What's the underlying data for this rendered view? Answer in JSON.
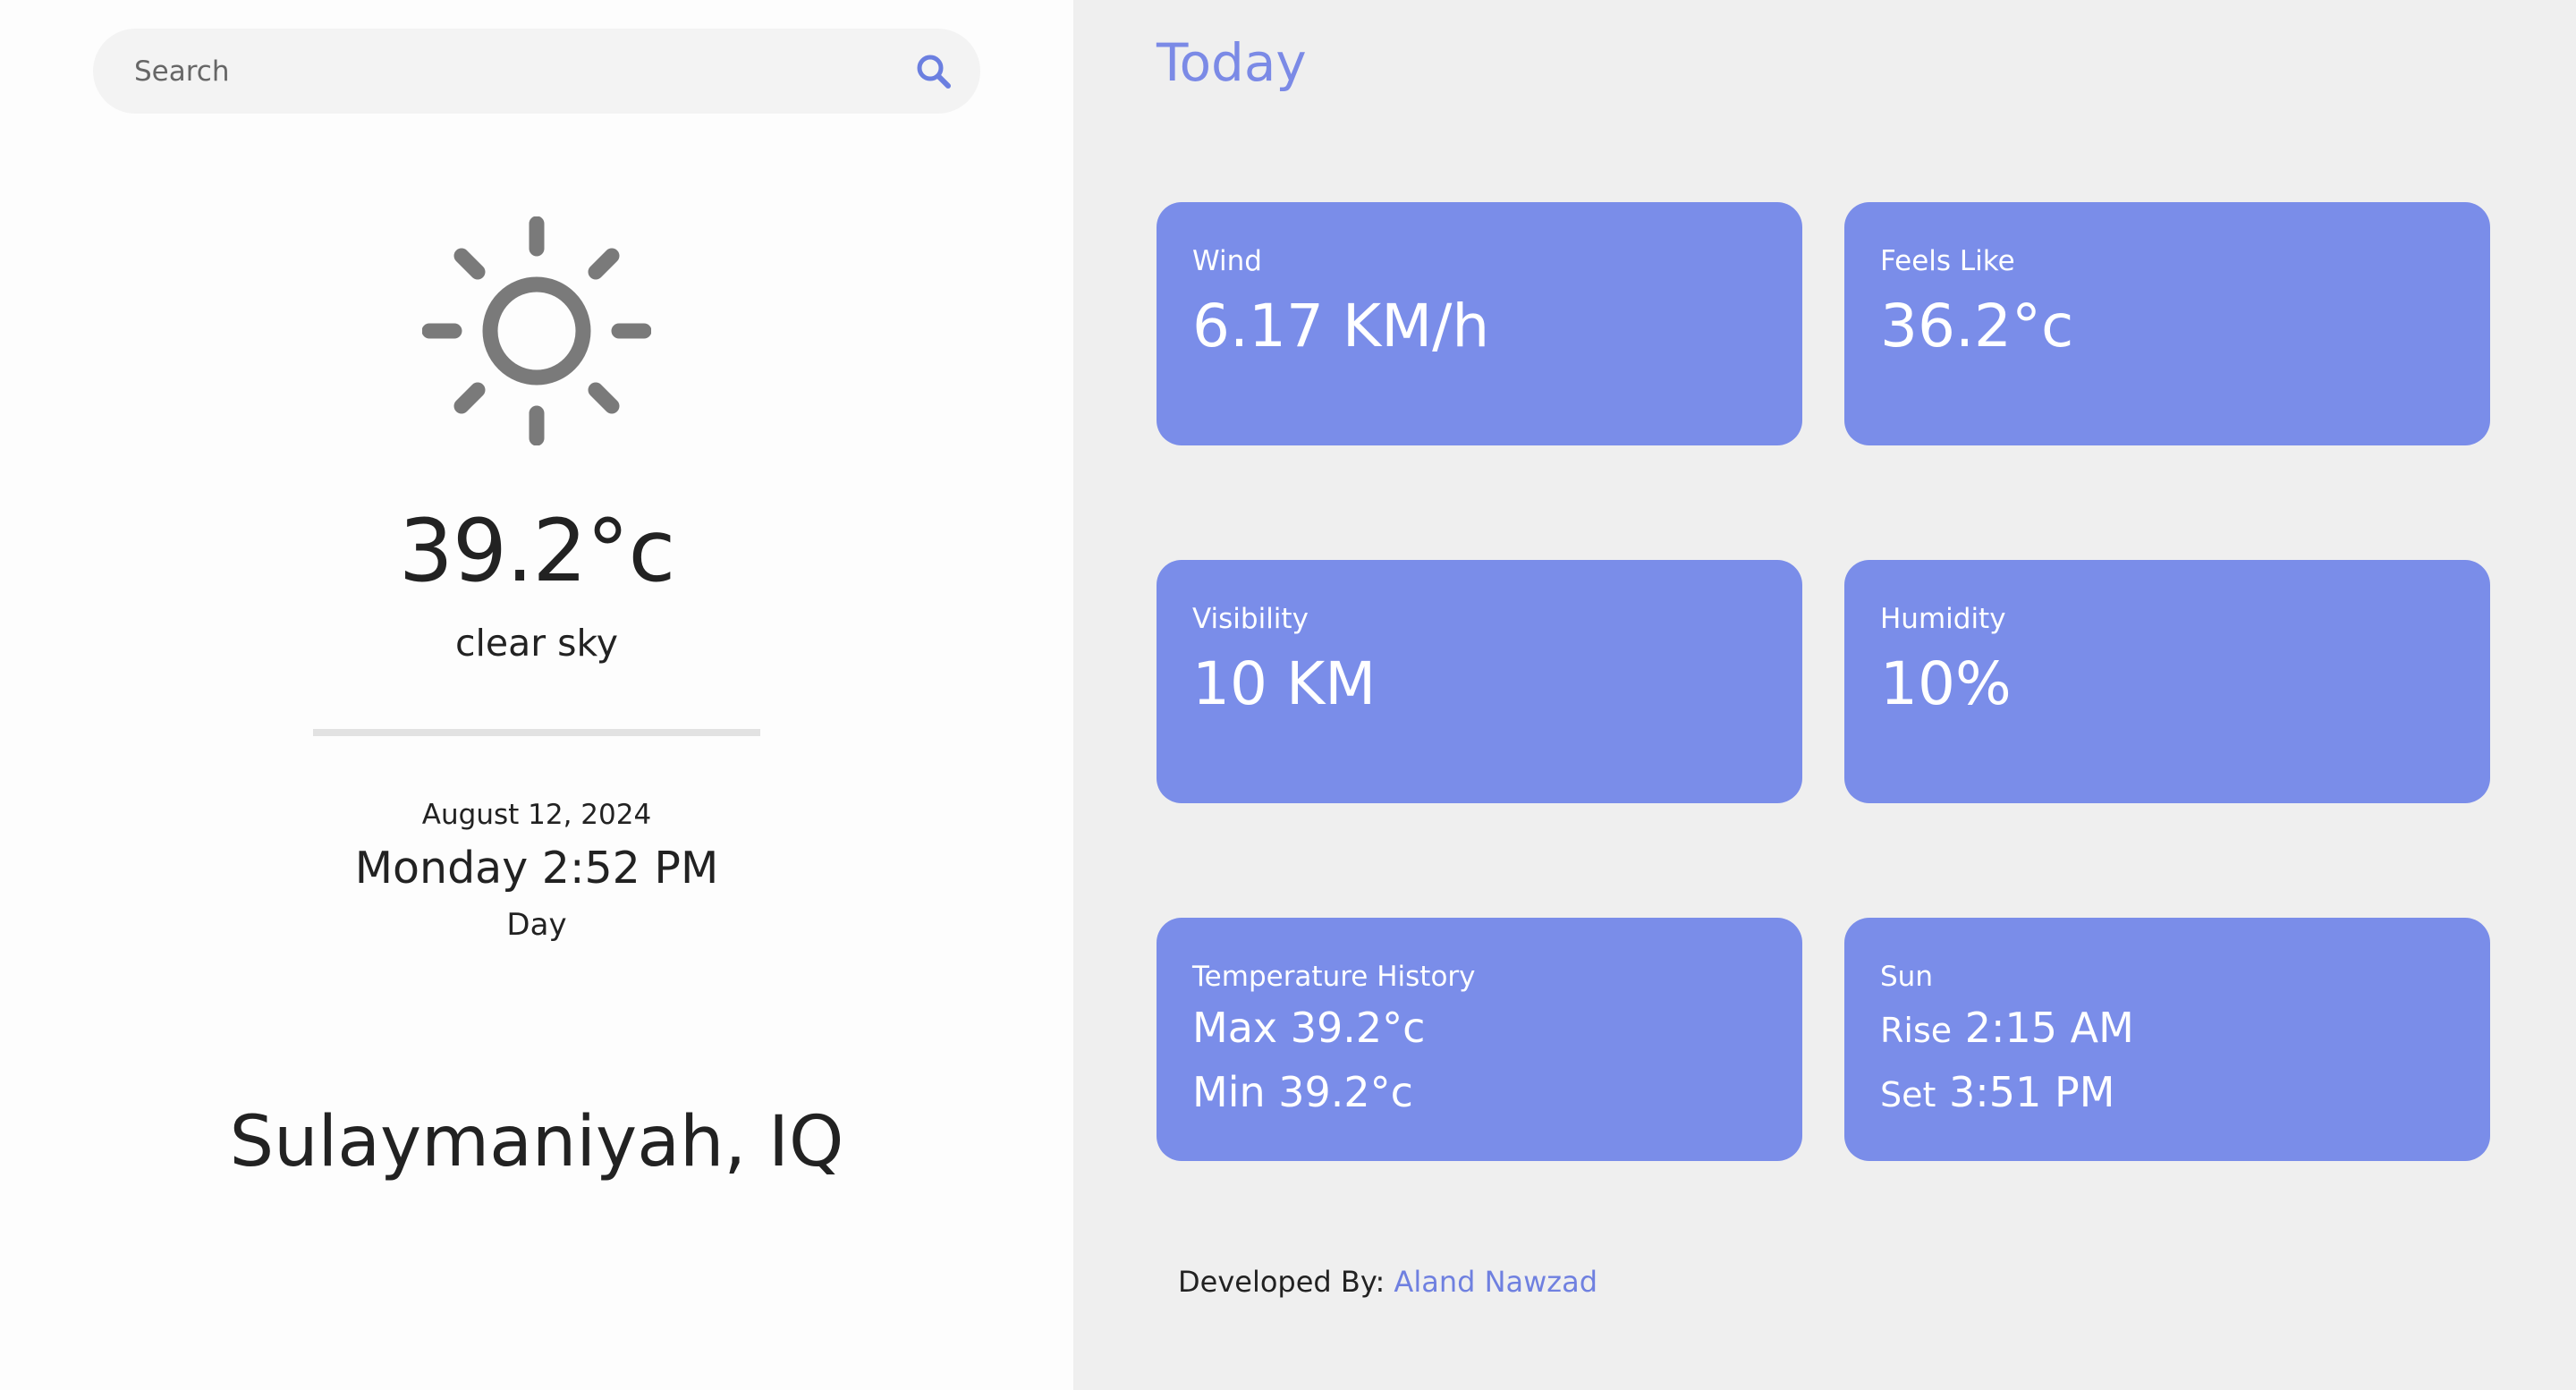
{
  "search": {
    "placeholder": "Search",
    "icon": "search-icon"
  },
  "current": {
    "icon": "sun-icon",
    "temperature": "39.2°c",
    "description": "clear sky",
    "date": "August 12, 2024",
    "day_time": "Monday 2:52 PM",
    "period": "Day",
    "city": "Sulaymaniyah, IQ"
  },
  "today": {
    "title": "Today",
    "wind": {
      "label": "Wind",
      "value": "6.17 KM/h"
    },
    "feels_like": {
      "label": "Feels Like",
      "value": "36.2°c"
    },
    "visibility": {
      "label": "Visibility",
      "value": "10 KM"
    },
    "humidity": {
      "label": "Humidity",
      "value": "10%"
    },
    "temperature_history": {
      "label": "Temperature History",
      "max": "Max 39.2°c",
      "min": "Min 39.2°c"
    },
    "sun": {
      "label": "Sun",
      "rise_label": "Rise",
      "rise_time": "2:15 AM",
      "set_label": "Set",
      "set_time": "3:51 PM"
    }
  },
  "footer": {
    "prefix": "Developed By:",
    "author": "Aland Nawzad"
  },
  "colors": {
    "accent": "#7a8de9",
    "link": "#6f80e0",
    "sidebar_bg": "#fdfdfd",
    "main_bg": "#efefef",
    "icon_gray": "#7a7a7a"
  }
}
